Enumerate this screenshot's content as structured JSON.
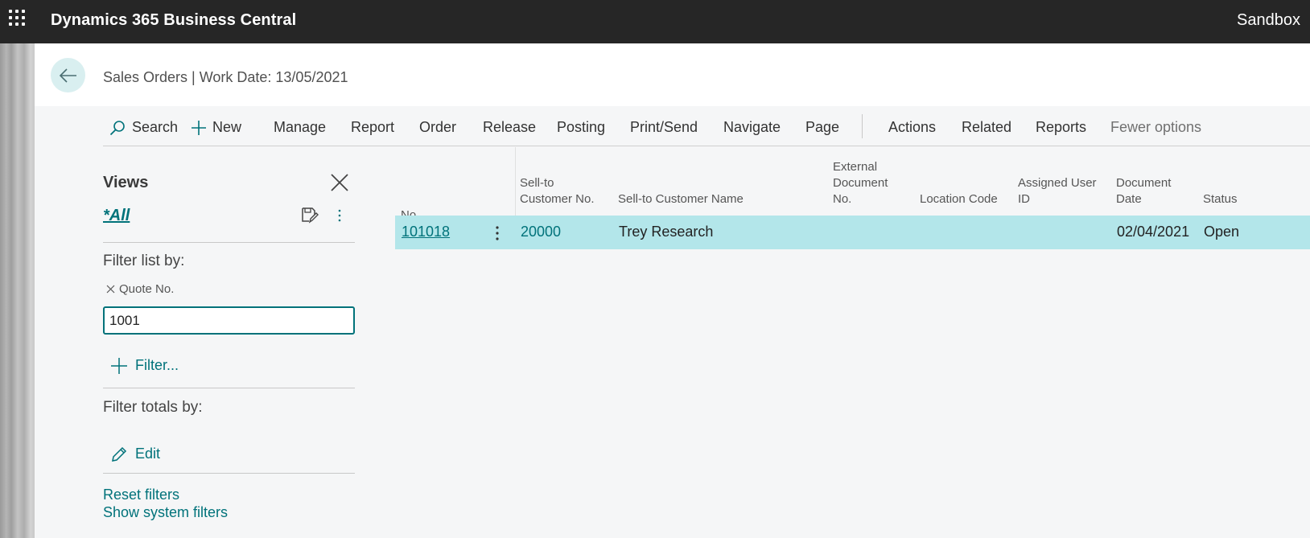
{
  "app": {
    "title": "Dynamics 365 Business Central",
    "environment": "Sandbox"
  },
  "page": {
    "title": "Sales Orders | Work Date: 13/05/2021"
  },
  "actions": {
    "search": "Search",
    "new": "New",
    "manage": "Manage",
    "report": "Report",
    "order": "Order",
    "release": "Release",
    "posting": "Posting",
    "print_send": "Print/Send",
    "navigate": "Navigate",
    "page": "Page",
    "actions": "Actions",
    "related": "Related",
    "reports": "Reports",
    "fewer_options": "Fewer options"
  },
  "views": {
    "title": "Views",
    "current": "*All",
    "filter_list_by": "Filter list by:",
    "filter_field": "Quote No.",
    "filter_value": "1001",
    "add_filter": "Filter...",
    "filter_totals_by": "Filter totals by:",
    "edit": "Edit",
    "reset_filters": "Reset filters",
    "show_system_filters": "Show system filters"
  },
  "table": {
    "columns": {
      "no": "No.",
      "sell_to_customer_no": "Sell-to\nCustomer No.",
      "sell_to_customer_name": "Sell-to Customer Name",
      "external_document_no": "External\nDocument\nNo.",
      "location_code": "Location Code",
      "assigned_user_id": "Assigned User\nID",
      "document_date": "Document\nDate",
      "status": "Status"
    },
    "rows": [
      {
        "no": "101018",
        "sell_to_customer_no": "20000",
        "sell_to_customer_name": "Trey Research",
        "external_document_no": "",
        "location_code": "",
        "assigned_user_id": "",
        "document_date": "02/04/2021",
        "status": "Open"
      }
    ]
  },
  "colors": {
    "accent": "#00727a",
    "topbar": "#262626",
    "selected_row": "#b3e6ea",
    "back_button": "#d9eff0"
  }
}
